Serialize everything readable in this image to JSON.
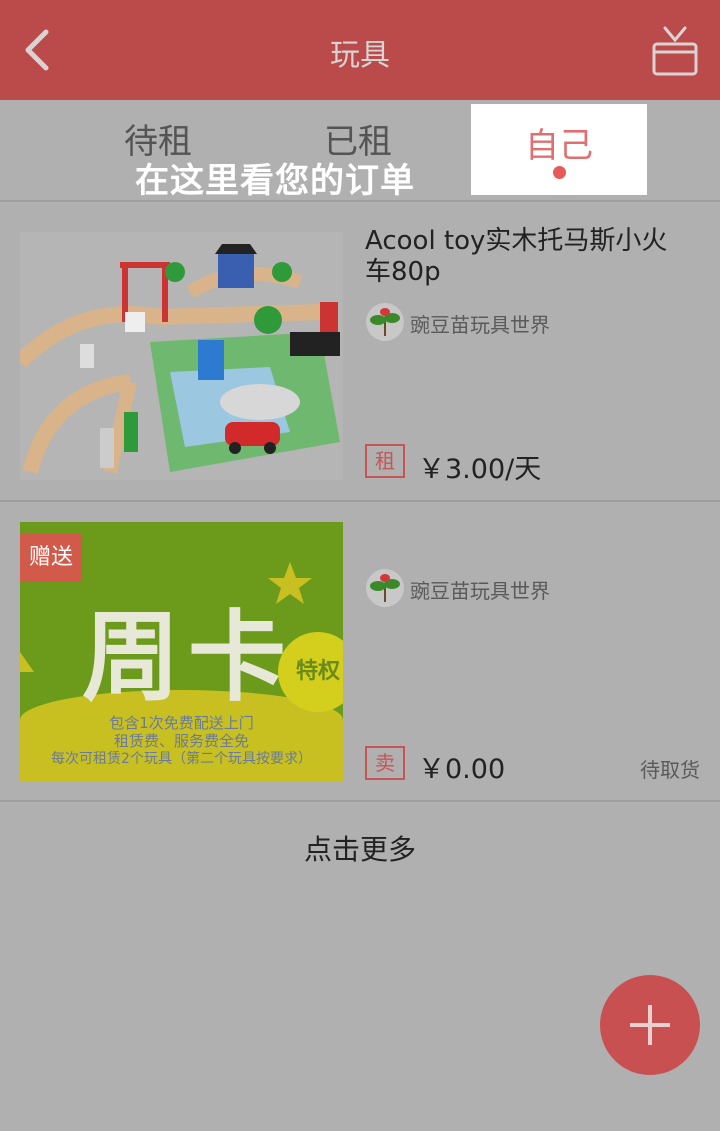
{
  "header": {
    "title": "玩具",
    "back_icon": "back-arrow-icon",
    "gift_icon": "gift-box-icon"
  },
  "tabs": [
    {
      "label": "待租"
    },
    {
      "label": "已租"
    },
    {
      "label": "自己",
      "active": true
    }
  ],
  "hint": "在这里看您的订单",
  "orders": [
    {
      "name": "Acool toy实木托马斯小火车80p",
      "shop": "豌豆苗玩具世界",
      "tag": "租",
      "price": "￥3.00/天",
      "status": ""
    },
    {
      "name": "",
      "shop": "豌豆苗玩具世界",
      "tag": "卖",
      "price": "￥0.00",
      "status": "待取货",
      "image_text": {
        "badge": "赠送",
        "title": "周卡",
        "privilege": "特权",
        "lines": [
          "包含1次免费配送上门",
          "租赁费、服务费全免",
          "每次可租赁2个玩具（第二个玩具按要求）"
        ]
      }
    }
  ],
  "more_label": "点击更多",
  "colors": {
    "header_bg": "#bb4a4a",
    "accent": "#c95050",
    "page_bg": "#b0b0b0"
  },
  "fab_icon": "plus-icon"
}
